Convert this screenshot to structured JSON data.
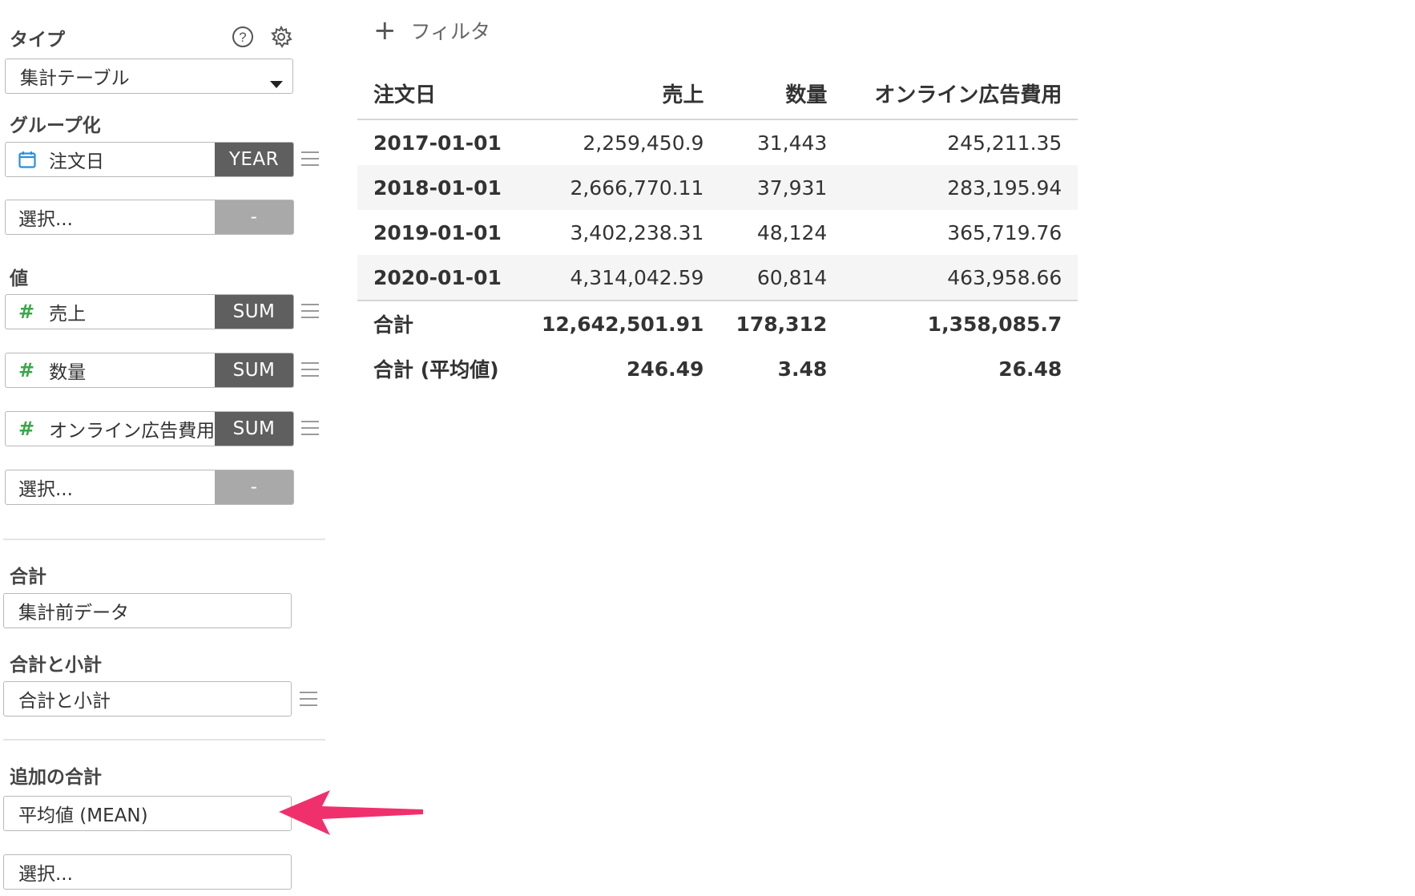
{
  "sidebar": {
    "type_label": "タイプ",
    "type_value": "集計テーブル",
    "group_label": "グループ化",
    "group_field": "注文日",
    "group_agg": "YEAR",
    "group_select_placeholder": "選択...",
    "group_select_agg": "-",
    "values_label": "値",
    "value_items": [
      {
        "field": "売上",
        "agg": "SUM"
      },
      {
        "field": "数量",
        "agg": "SUM"
      },
      {
        "field": "オンライン広告費用",
        "agg": "SUM"
      }
    ],
    "values_select_placeholder": "選択...",
    "values_select_agg": "-",
    "total_label": "合計",
    "total_value": "集計前データ",
    "subtotal_label": "合計と小計",
    "subtotal_value": "合計と小計",
    "additional_label": "追加の合計",
    "additional_value": "平均値 (MEAN)",
    "additional_select_placeholder": "選択..."
  },
  "toolbar": {
    "filter_label": "フィルタ"
  },
  "table": {
    "headers": [
      "注文日",
      "売上",
      "数量",
      "オンライン広告費用"
    ],
    "rows": [
      [
        "2017-01-01",
        "2,259,450.9",
        "31,443",
        "245,211.35"
      ],
      [
        "2018-01-01",
        "2,666,770.11",
        "37,931",
        "283,195.94"
      ],
      [
        "2019-01-01",
        "3,402,238.31",
        "48,124",
        "365,719.76"
      ],
      [
        "2020-01-01",
        "4,314,042.59",
        "60,814",
        "463,958.66"
      ]
    ],
    "footer": [
      [
        "合計",
        "12,642,501.91",
        "178,312",
        "1,358,085.7"
      ],
      [
        "合計 (平均値)",
        "246.49",
        "3.48",
        "26.48"
      ]
    ]
  },
  "colors": {
    "agg_button": "#5f5f5f",
    "agg_empty": "#a9a9a9",
    "hash_icon": "#3aa74a",
    "calendar_icon": "#2b8fd6",
    "annotation_arrow": "#f0306d"
  }
}
